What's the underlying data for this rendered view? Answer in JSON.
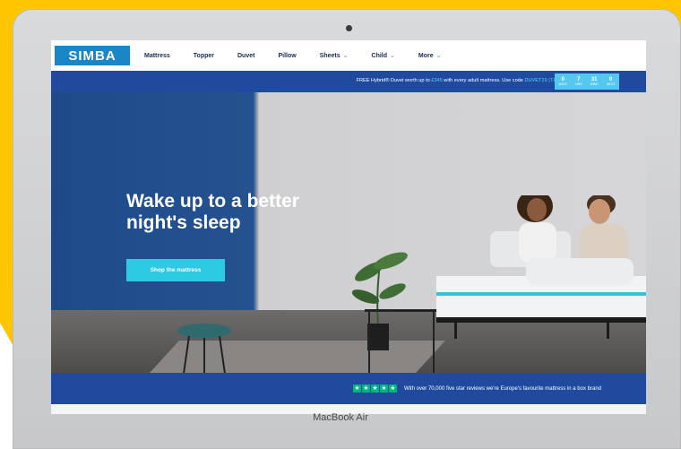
{
  "site": {
    "logo": "SIMBA",
    "nav": [
      "Mattress",
      "Topper",
      "Duvet",
      "Pillow",
      "Sheets",
      "Child",
      "More"
    ],
    "promo": {
      "pre": "FREE Hybrid® Duvet worth up to ",
      "price": "£345",
      "mid": " with every adult mattress. Use code ",
      "code": "DUVET19",
      "tc": "(T&C's)"
    },
    "countdown": [
      {
        "value": "0",
        "label": "DAYS"
      },
      {
        "value": "7",
        "label": "HRS"
      },
      {
        "value": "31",
        "label": "MINS"
      },
      {
        "value": "0",
        "label": "SECS"
      }
    ],
    "hero": {
      "headline_line1": "Wake up to a better",
      "headline_line2": "night's sleep",
      "cta": "Shop the mattress"
    },
    "trust": {
      "text": "With over 70,000 five star reviews we're Europe's favourite mattress in a box brand"
    }
  },
  "device": {
    "brand": "MacBook Air"
  }
}
